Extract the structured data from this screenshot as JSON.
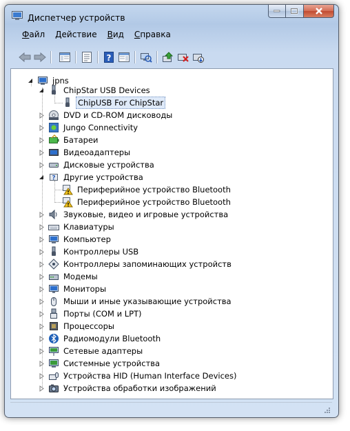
{
  "window": {
    "title": "Диспетчер устройств"
  },
  "menu": [
    "Файл",
    "Действие",
    "Вид",
    "Справка"
  ],
  "toolbar": [
    {
      "name": "back-arrow-icon"
    },
    {
      "name": "forward-arrow-icon"
    },
    {
      "name": "show-hide-console-tree-icon"
    },
    {
      "name": "properties-icon"
    },
    {
      "name": "help-icon"
    },
    {
      "name": "action-pane-icon"
    },
    {
      "name": "scan-hardware-icon"
    },
    {
      "name": "update-driver-icon"
    },
    {
      "name": "uninstall-device-icon"
    },
    {
      "name": "disable-device-icon"
    }
  ],
  "tree": {
    "root": "jpns",
    "expanded_group": {
      "label": "ChipStar USB Devices",
      "child": "ChipUSB For ChipStar"
    },
    "categories": [
      {
        "label": "DVD и CD-ROM дисководы",
        "icon": "dvd-drive-icon"
      },
      {
        "label": "Jungo Connectivity",
        "icon": "jungo-icon"
      },
      {
        "label": "Батареи",
        "icon": "battery-icon"
      },
      {
        "label": "Видеоадаптеры",
        "icon": "display-adapter-icon"
      },
      {
        "label": "Дисковые устройства",
        "icon": "disk-drive-icon"
      }
    ],
    "other_devices": {
      "label": "Другие устройства",
      "children": [
        "Периферийное устройство Bluetooth",
        "Периферийное устройство Bluetooth"
      ]
    },
    "categories2": [
      {
        "label": "Звуковые, видео и игровые устройства",
        "icon": "speaker-icon"
      },
      {
        "label": "Клавиатуры",
        "icon": "keyboard-icon"
      },
      {
        "label": "Компьютер",
        "icon": "computer-icon"
      },
      {
        "label": "Контроллеры USB",
        "icon": "usb-icon"
      },
      {
        "label": "Контроллеры запоминающих устройств",
        "icon": "storage-controller-icon"
      },
      {
        "label": "Модемы",
        "icon": "modem-icon"
      },
      {
        "label": "Мониторы",
        "icon": "monitor-icon"
      },
      {
        "label": "Мыши и иные указывающие устройства",
        "icon": "mouse-icon"
      },
      {
        "label": "Порты (COM и LPT)",
        "icon": "port-icon"
      },
      {
        "label": "Процессоры",
        "icon": "processor-icon"
      },
      {
        "label": "Радиомодули Bluetooth",
        "icon": "bluetooth-icon"
      },
      {
        "label": "Сетевые адаптеры",
        "icon": "network-adapter-icon"
      },
      {
        "label": "Системные устройства",
        "icon": "system-device-icon"
      },
      {
        "label": "Устройства HID (Human Interface Devices)",
        "icon": "hid-icon"
      },
      {
        "label": "Устройства обработки изображений",
        "icon": "imaging-device-icon"
      }
    ]
  }
}
